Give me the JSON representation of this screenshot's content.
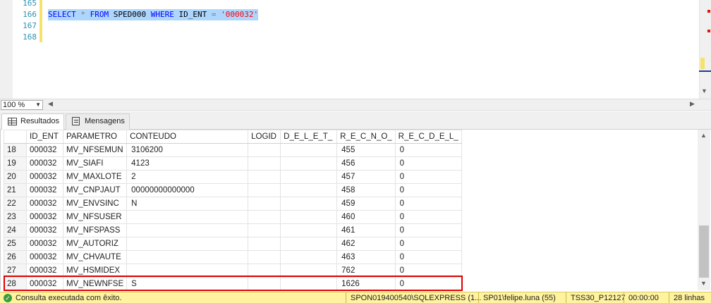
{
  "editor": {
    "line_numbers": [
      "165",
      "166",
      "167",
      "168"
    ],
    "query": {
      "select": "SELECT",
      "star": "*",
      "from": "FROM",
      "table": "SPED000",
      "where": "WHERE",
      "column": "ID_ENT",
      "equals": "=",
      "value": "'000032'"
    }
  },
  "zoom": {
    "value": "100 %"
  },
  "tabs": [
    {
      "label": "Resultados",
      "icon": "grid-icon",
      "active": true
    },
    {
      "label": "Mensagens",
      "icon": "messages-icon",
      "active": false
    }
  ],
  "grid": {
    "columns": [
      "ID_ENT",
      "PARAMETRO",
      "CONTEUDO",
      "LOGID",
      "D_E_L_E_T_",
      "R_E_C_N_O_",
      "R_E_C_D_E_L_"
    ],
    "rows": [
      [
        "18",
        "000032",
        "MV_NFSEMUN",
        "3106200",
        "",
        "",
        "455",
        "0"
      ],
      [
        "19",
        "000032",
        "MV_SIAFI",
        "4123",
        "",
        "",
        "456",
        "0"
      ],
      [
        "20",
        "000032",
        "MV_MAXLOTE",
        "2",
        "",
        "",
        "457",
        "0"
      ],
      [
        "21",
        "000032",
        "MV_CNPJAUT",
        "00000000000000",
        "",
        "",
        "458",
        "0"
      ],
      [
        "22",
        "000032",
        "MV_ENVSINC",
        "N",
        "",
        "",
        "459",
        "0"
      ],
      [
        "23",
        "000032",
        "MV_NFSUSER",
        "",
        "",
        "",
        "460",
        "0"
      ],
      [
        "24",
        "000032",
        "MV_NFSPASS",
        "",
        "",
        "",
        "461",
        "0"
      ],
      [
        "25",
        "000032",
        "MV_AUTORIZ",
        "",
        "",
        "",
        "462",
        "0"
      ],
      [
        "26",
        "000032",
        "MV_CHVAUTE",
        "",
        "",
        "",
        "463",
        "0"
      ],
      [
        "27",
        "000032",
        "MV_HSMIDEX",
        "",
        "",
        "",
        "762",
        "0"
      ],
      [
        "28",
        "000032",
        "MV_NEWNFSE",
        "S",
        "",
        "",
        "1626",
        "0"
      ]
    ],
    "highlighted_row": 10,
    "highlight_color": "#e00000"
  },
  "status": {
    "message": "Consulta executada com êxito.",
    "server": "SPON019400540\\SQLEXPRESS (1...",
    "user": "SP01\\felipe.luna (55)",
    "database": "TSS30_P12127",
    "elapsed": "00:00:00",
    "rows": "28 linhas"
  },
  "colors": {
    "keyword": "#0000ff",
    "string": "#ff0000",
    "selection": "#add6ff",
    "status_bar": "#fff3a0"
  }
}
